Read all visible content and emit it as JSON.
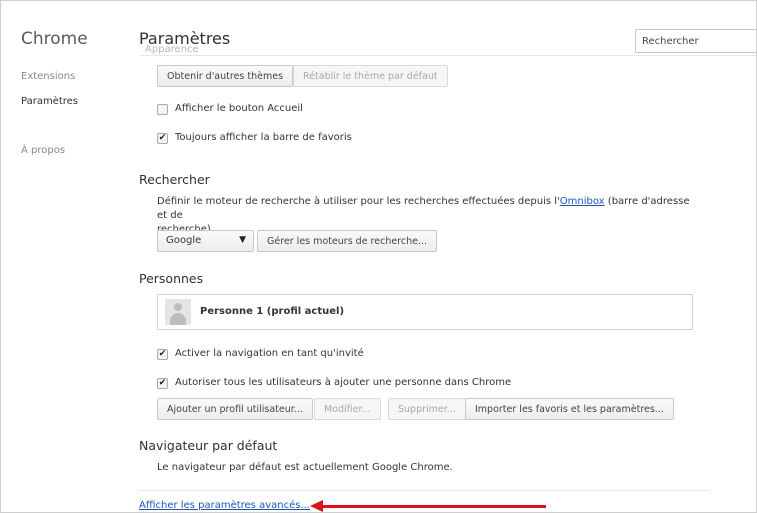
{
  "sidebar": {
    "brand": "Chrome",
    "items": [
      {
        "label": "Extensions"
      },
      {
        "label": "Paramètres"
      },
      {
        "label": "À propos"
      }
    ]
  },
  "header": {
    "title": "Paramètres",
    "cut_heading": "Apparence",
    "search_placeholder": "Rechercher"
  },
  "appearance": {
    "get_themes_label": "Obtenir d'autres thèmes",
    "reset_theme_label": "Rétablir le thème par défaut",
    "show_home_label": "Afficher le bouton Accueil",
    "show_home_checked": false,
    "show_bookmarks_label": "Toujours afficher la barre de favoris",
    "show_bookmarks_checked": true
  },
  "search": {
    "title": "Rechercher",
    "desc_before": "Définir le moteur de recherche à utiliser pour les recherches effectuées depuis l'",
    "desc_link": "Omnibox",
    "desc_after": " (barre d'adresse et de",
    "desc_line2": "recherche)",
    "engine_selected": "Google",
    "manage_label": "Gérer les moteurs de recherche..."
  },
  "people": {
    "title": "Personnes",
    "profile_name": "Personne 1 (profil actuel)",
    "guest_label": "Activer la navigation en tant qu'invité",
    "guest_checked": true,
    "allow_add_label": "Autoriser tous les utilisateurs à ajouter une personne dans Chrome",
    "allow_add_checked": true,
    "add_profile_label": "Ajouter un profil utilisateur...",
    "edit_label": "Modifier...",
    "delete_label": "Supprimer...",
    "import_label": "Importer les favoris et les paramètres..."
  },
  "default_browser": {
    "title": "Navigateur par défaut",
    "desc": "Le navigateur par défaut est actuellement Google Chrome."
  },
  "advanced_link": "Afficher les paramètres avancés...",
  "colors": {
    "link": "#1a58b8",
    "annotation_arrow": "#d9141a"
  }
}
